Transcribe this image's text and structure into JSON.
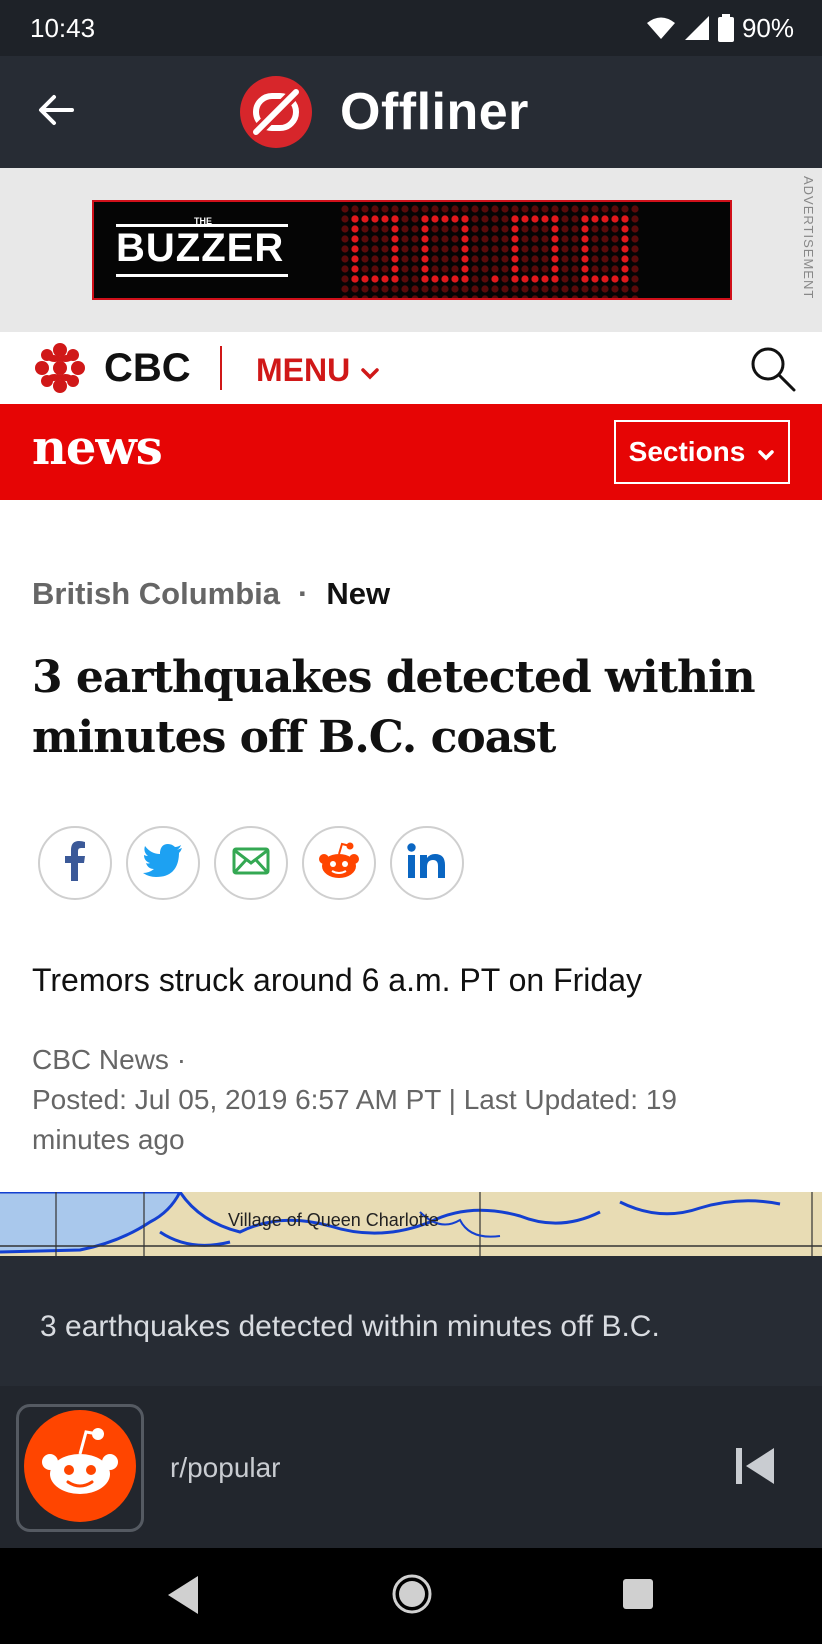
{
  "status_bar": {
    "time": "10:43",
    "battery": "90%",
    "icons": [
      "wifi-icon",
      "cell-signal-icon",
      "battery-icon"
    ]
  },
  "app_bar": {
    "title": "Offliner",
    "back_icon": "arrow-left-icon",
    "logo_icon": "offliner-logo-icon"
  },
  "advertisement": {
    "label": "ADVERTISEMENT",
    "brand": "BUZZER",
    "brand_prefix": "THE"
  },
  "cbc_header": {
    "brand": "CBC",
    "menu_label": "MENU",
    "search_icon": "search-icon"
  },
  "news_bar": {
    "logo": "news",
    "sections_label": "Sections"
  },
  "article": {
    "kicker_region": "British Columbia",
    "kicker_separator": "·",
    "kicker_status": "New",
    "headline": "3 earthquakes detected within minutes off B.C. coast",
    "share_icons": [
      "facebook-icon",
      "twitter-icon",
      "email-icon",
      "reddit-icon",
      "linkedin-icon"
    ],
    "deck": "Tremors struck around 6 a.m. PT on Friday",
    "byline_source": "CBC News ·",
    "byline_posted": "Posted: Jul 05, 2019 6:57 AM PT | Last Updated: 19 minutes ago",
    "map_label": "Village of Queen Charlotte"
  },
  "caption": {
    "text": "3 earthquakes detected within minutes off B.C."
  },
  "dock": {
    "label": "r/popular",
    "avatar_icon": "reddit-icon",
    "skip_icon": "skip-previous-icon"
  },
  "nav_bar": {
    "icons": [
      "nav-back-icon",
      "nav-home-icon",
      "nav-recents-icon"
    ]
  },
  "colors": {
    "cbc_red": "#e60505",
    "app_bar": "#272c34",
    "status_bar": "#1e2228",
    "reddit_orange": "#ff4500"
  }
}
